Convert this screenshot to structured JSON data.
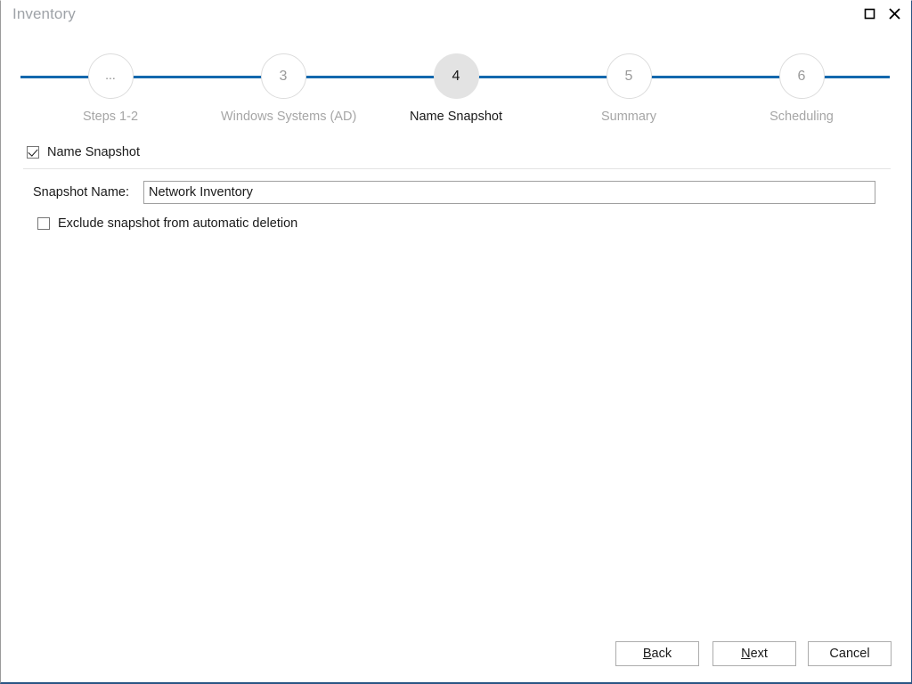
{
  "window": {
    "title": "Inventory",
    "controls": [
      {
        "name": "restore-button",
        "icon": "restore-icon"
      },
      {
        "name": "close-button",
        "icon": "close-icon"
      }
    ]
  },
  "stepper": {
    "line_color": "#1368ad",
    "active_index": 2,
    "steps": [
      {
        "number": "...",
        "label": "Steps 1-2",
        "active": false
      },
      {
        "number": "3",
        "label": "Windows Systems (AD)",
        "active": false
      },
      {
        "number": "4",
        "label": "Name Snapshot",
        "active": true
      },
      {
        "number": "5",
        "label": "Summary",
        "active": false
      },
      {
        "number": "6",
        "label": "Scheduling",
        "active": false
      }
    ]
  },
  "form": {
    "group_checkbox": {
      "label": "Name Snapshot",
      "checked": true
    },
    "snapshot_name": {
      "label": "Snapshot Name:",
      "value": "Network Inventory",
      "placeholder": ""
    },
    "exclude_checkbox": {
      "label": "Exclude snapshot from automatic deletion",
      "checked": false
    }
  },
  "footer": {
    "back": {
      "accel": "B",
      "rest": "ack"
    },
    "next": {
      "accel": "N",
      "rest": "ext"
    },
    "cancel": {
      "label": "Cancel"
    }
  }
}
